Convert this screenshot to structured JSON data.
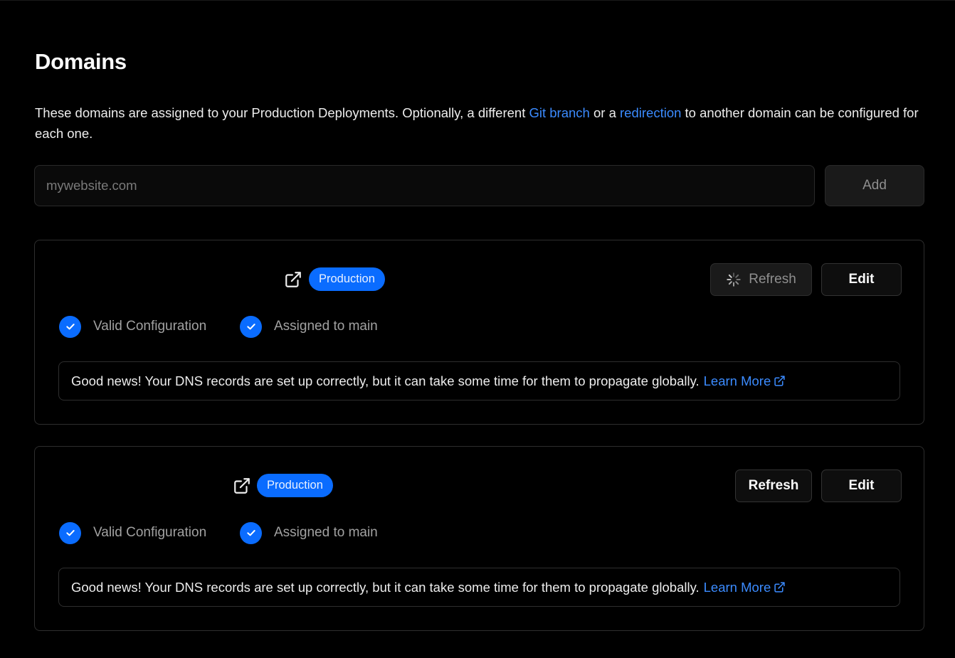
{
  "page": {
    "title": "Domains",
    "description": {
      "part1": "These domains are assigned to your Production Deployments. Optionally, a different ",
      "link1": "Git branch",
      "part2": " or a ",
      "link2": "redirection",
      "part3": " to another domain can be configured for each one."
    }
  },
  "add_domain": {
    "placeholder": "mywebsite.com",
    "value": "",
    "button_label": "Add"
  },
  "domains": [
    {
      "environment_badge": "Production",
      "refresh_label": "Refresh",
      "refresh_state": "loading",
      "edit_label": "Edit",
      "status": [
        {
          "icon": "check-circle-icon",
          "label": "Valid Configuration"
        },
        {
          "icon": "check-circle-icon",
          "label": "Assigned to main"
        }
      ],
      "message": "Good news! Your DNS records are set up correctly, but it can take some time for them to propagate globally.",
      "learn_more": "Learn More"
    },
    {
      "environment_badge": "Production",
      "refresh_label": "Refresh",
      "refresh_state": "idle",
      "edit_label": "Edit",
      "status": [
        {
          "icon": "check-circle-icon",
          "label": "Valid Configuration"
        },
        {
          "icon": "check-circle-icon",
          "label": "Assigned to main"
        }
      ],
      "message": "Good news! Your DNS records are set up correctly, but it can take some time for them to propagate globally.",
      "learn_more": "Learn More"
    }
  ],
  "icons": {
    "external_link": "external-link-icon",
    "check": "check-circle-icon",
    "spinner": "spinner-icon"
  },
  "colors": {
    "background": "#000000",
    "accent_blue": "#0a6cff",
    "link_blue": "#3b8bff",
    "border": "#2e2e2e",
    "muted_text": "#a1a1a1"
  }
}
